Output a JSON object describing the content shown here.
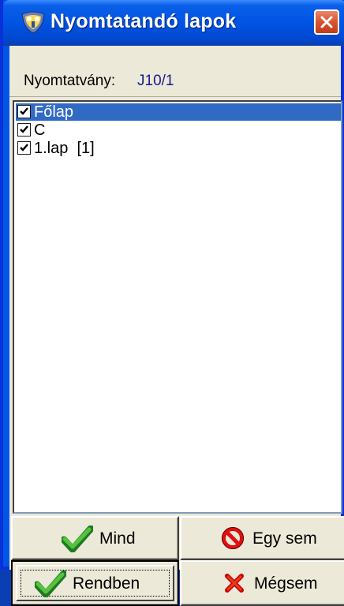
{
  "window": {
    "title": "Nyomtatandó lapok",
    "titlebar_color": "#0054e3",
    "close_color": "#d8532f"
  },
  "form": {
    "label": "Nyomtatvány:",
    "value": "J10/1"
  },
  "list": {
    "items": [
      {
        "label": "Főlap",
        "checked": true,
        "selected": true
      },
      {
        "label": "C",
        "checked": true,
        "selected": false
      },
      {
        "label": "1.lap  [1]",
        "checked": true,
        "selected": false
      }
    ],
    "selection_color": "#316ac5"
  },
  "buttons": {
    "mind": "Mind",
    "egy_sem": "Egy sem",
    "rendben": "Rendben",
    "megsem": "Mégsem"
  },
  "icons": {
    "app": "shield-icon",
    "close": "close-icon",
    "mind": "checkmark-icon",
    "egy_sem": "no-entry-icon",
    "rendben": "checkmark-icon",
    "megsem": "x-cancel-icon"
  }
}
